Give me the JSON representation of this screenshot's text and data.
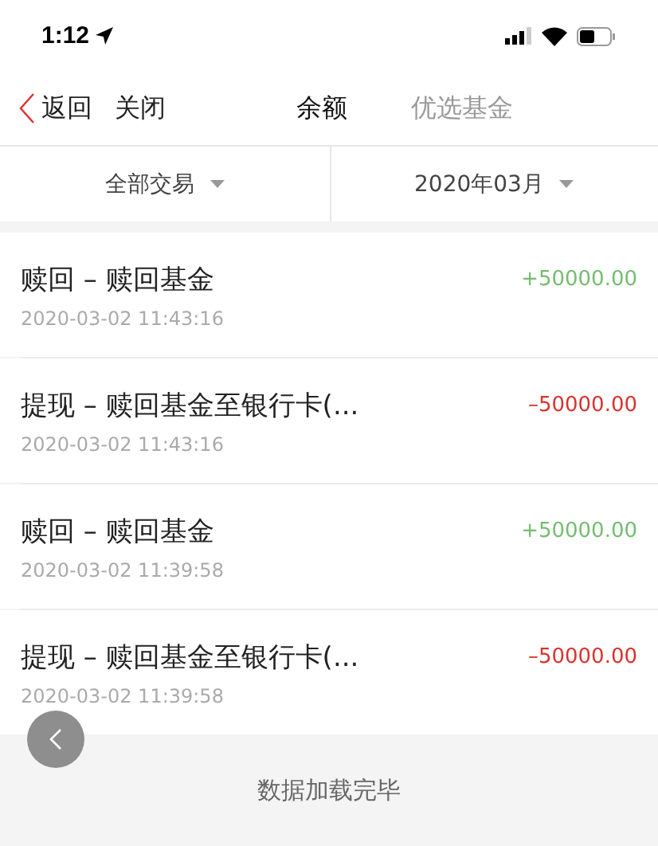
{
  "status_bar": {
    "time": "1:12"
  },
  "nav": {
    "back": "返回",
    "close": "关闭",
    "tabs": [
      {
        "label": "余额",
        "selected": true
      },
      {
        "label": "优选基金",
        "selected": false
      }
    ]
  },
  "filters": [
    {
      "label": "全部交易"
    },
    {
      "label": "2020年03月"
    }
  ],
  "transactions": [
    {
      "title": "赎回 – 赎回基金",
      "time": "2020-03-02 11:43:16",
      "amount": "+50000.00",
      "color": "#74bd6f"
    },
    {
      "title": "提现 – 赎回基金至银行卡(...",
      "time": "2020-03-02 11:43:16",
      "amount": "–50000.00",
      "color": "#d8322d"
    },
    {
      "title": "赎回 – 赎回基金",
      "time": "2020-03-02 11:39:58",
      "amount": "+50000.00",
      "color": "#74bd6f"
    },
    {
      "title": "提现 – 赎回基金至银行卡(...",
      "time": "2020-03-02 11:39:58",
      "amount": "–50000.00",
      "color": "#d8322d"
    }
  ],
  "footer": "数据加载完毕"
}
